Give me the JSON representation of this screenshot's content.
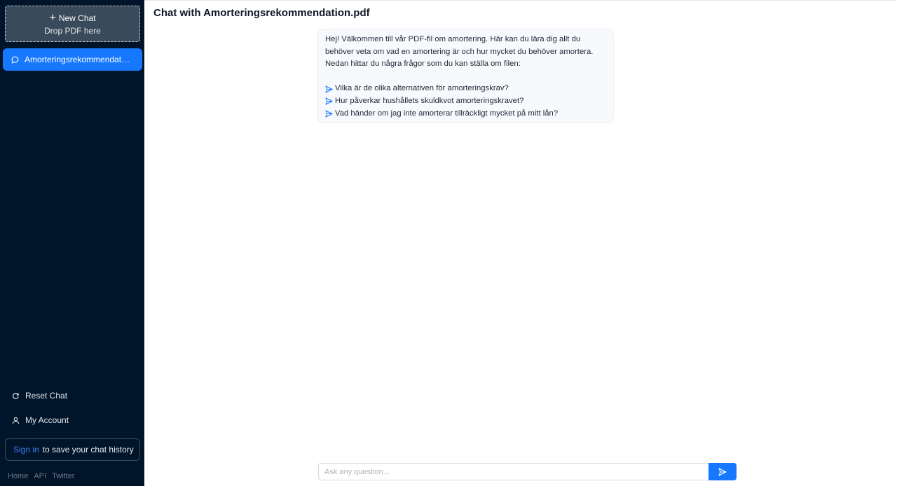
{
  "sidebar": {
    "new_chat_label": "New Chat",
    "drop_label": "Drop PDF here",
    "chats": [
      {
        "label": "Amorteringsrekommendation.pdf"
      }
    ],
    "reset_label": "Reset Chat",
    "account_label": "My Account",
    "signin_link": "Sign in",
    "signin_text": "to save your chat history",
    "footer": [
      "Home",
      "API",
      "Twitter"
    ]
  },
  "main": {
    "title": "Chat with Amorteringsrekommendation.pdf",
    "message": {
      "intro": "Hej! Välkommen till vår PDF-fil om amortering. Här kan du lära dig allt du behöver veta om vad en amortering är och hur mycket du behöver amortera. Nedan hittar du några frågor som du kan ställa om filen:",
      "questions": [
        "Vilka är de olika alternativen för amorteringskrav?",
        "Hur påverkar hushållets skuldkvot amorteringskravet?",
        "Vad händer om jag inte amorterar tillräckligt mycket på mitt lån?"
      ]
    },
    "input": {
      "placeholder": "Ask any question...",
      "value": ""
    }
  },
  "colors": {
    "sidebar_bg": "#001529",
    "accent": "#1677ff"
  }
}
